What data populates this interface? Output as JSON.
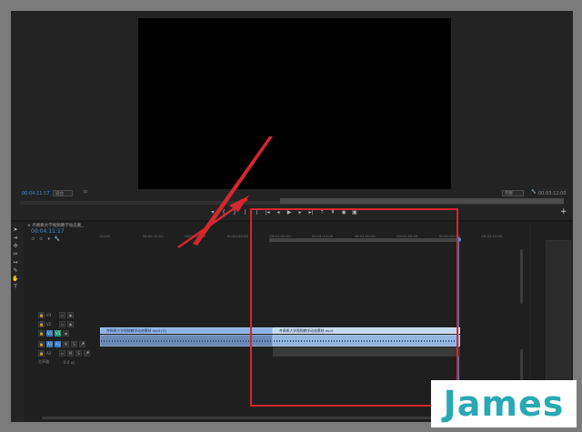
{
  "program_monitor": {
    "timecode": "00:04:11:17",
    "fit_label": "适合",
    "quality_label": "完整",
    "duration": "00:03:12:00"
  },
  "transport_icons": [
    "marker-icon",
    "in-point-icon",
    "out-point-icon",
    "go-to-in-icon",
    "go-to-out-icon",
    "step-back-icon",
    "play-icon",
    "step-forward-icon",
    "go-to-out-point-icon",
    "lift-icon",
    "extract-icon",
    "export-frame-icon",
    "comparison-icon"
  ],
  "add_button": "+",
  "tools": [
    "selection-tool-icon",
    "track-select-icon",
    "ripple-edit-icon",
    "razor-tool-icon",
    "slip-tool-icon",
    "pen-tool-icon",
    "hand-tool-icon",
    "type-tool-icon"
  ],
  "timeline": {
    "tab_label": "齐佩佩大学视频教学动态素_",
    "timecode": "00:04:11:17",
    "ruler_ticks": [
      "00:00",
      "00:00:15:00",
      "00:00:30:00",
      "00:00:45:00",
      "00:01:00:00",
      "00:01:15:00",
      "00:01:30:00",
      "00:01:45:00",
      "00:02:00:00",
      "00:02:15:00"
    ],
    "tracks": [
      {
        "label": "V3"
      },
      {
        "label": "V2"
      },
      {
        "label": "V1"
      },
      {
        "label": "A1"
      },
      {
        "label": "A2"
      }
    ],
    "master_label": "主声道",
    "master_value": "0.0",
    "clips": {
      "v1_a": "齐佩佩大学视频教学动态素材.mp4 [V]",
      "v1_b": "齐佩佩大学视频教学动态素材.mp4"
    }
  },
  "watermark": {
    "text": "James"
  },
  "colors": {
    "accent": "#4a8fd6",
    "annotation": "#d7262e",
    "clip_video": "#8bb1e6",
    "watermark_text": "#2aa9b4"
  }
}
